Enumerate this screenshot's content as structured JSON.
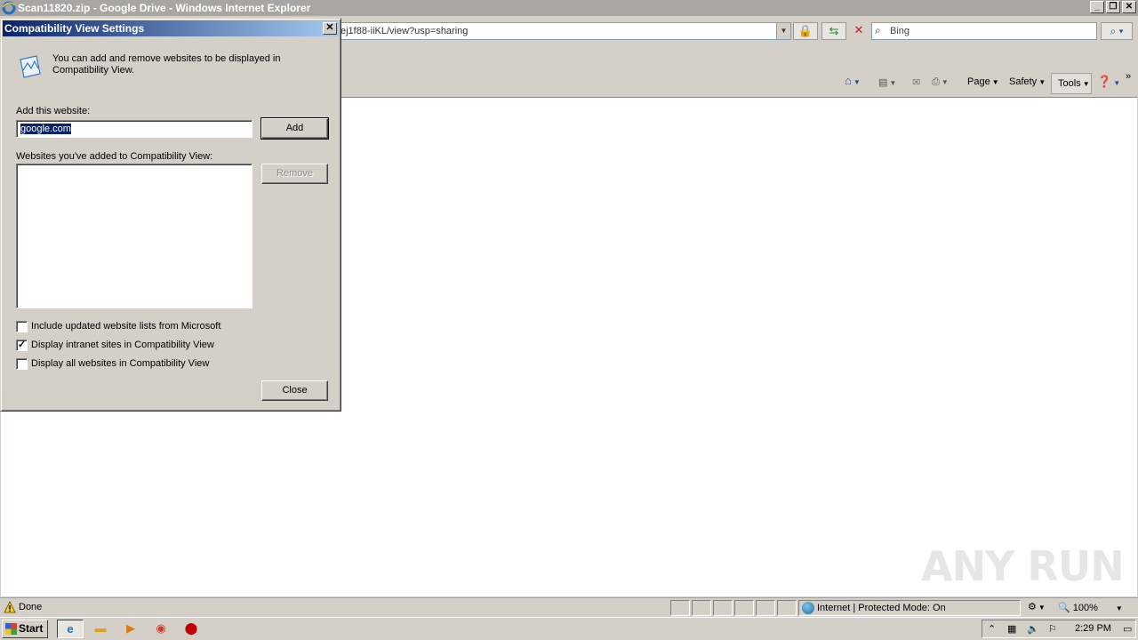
{
  "window": {
    "title": "Scan11820.zip - Google Drive - Windows Internet Explorer",
    "buttons": [
      "_",
      "❐",
      "✕"
    ]
  },
  "navbar": {
    "address": "ej1f88-iiKL/view?usp=sharing",
    "search_placeholder": "Bing"
  },
  "commandbar": {
    "page_label": "Page",
    "safety_label": "Safety",
    "tools_label": "Tools"
  },
  "dialog": {
    "title": "Compatibility View Settings",
    "close_glyph": "✕",
    "description": "You can add and remove websites to be displayed in Compatibility View.",
    "add_label": "Add this website:",
    "add_value": "google.com",
    "add_button": "Add",
    "list_label": "Websites you've added to Compatibility View:",
    "remove_button": "Remove",
    "options": [
      {
        "label": "Include updated website lists from Microsoft",
        "checked": false
      },
      {
        "label": "Display intranet sites in Compatibility View",
        "checked": true
      },
      {
        "label": "Display all websites in Compatibility View",
        "checked": false
      }
    ],
    "close_button": "Close"
  },
  "statusbar": {
    "text": "Done",
    "zone": "Internet | Protected Mode: On",
    "zoom": "100%"
  },
  "taskbar": {
    "start": "Start",
    "clock": "2:29 PM"
  },
  "watermark": "ANY RUN"
}
